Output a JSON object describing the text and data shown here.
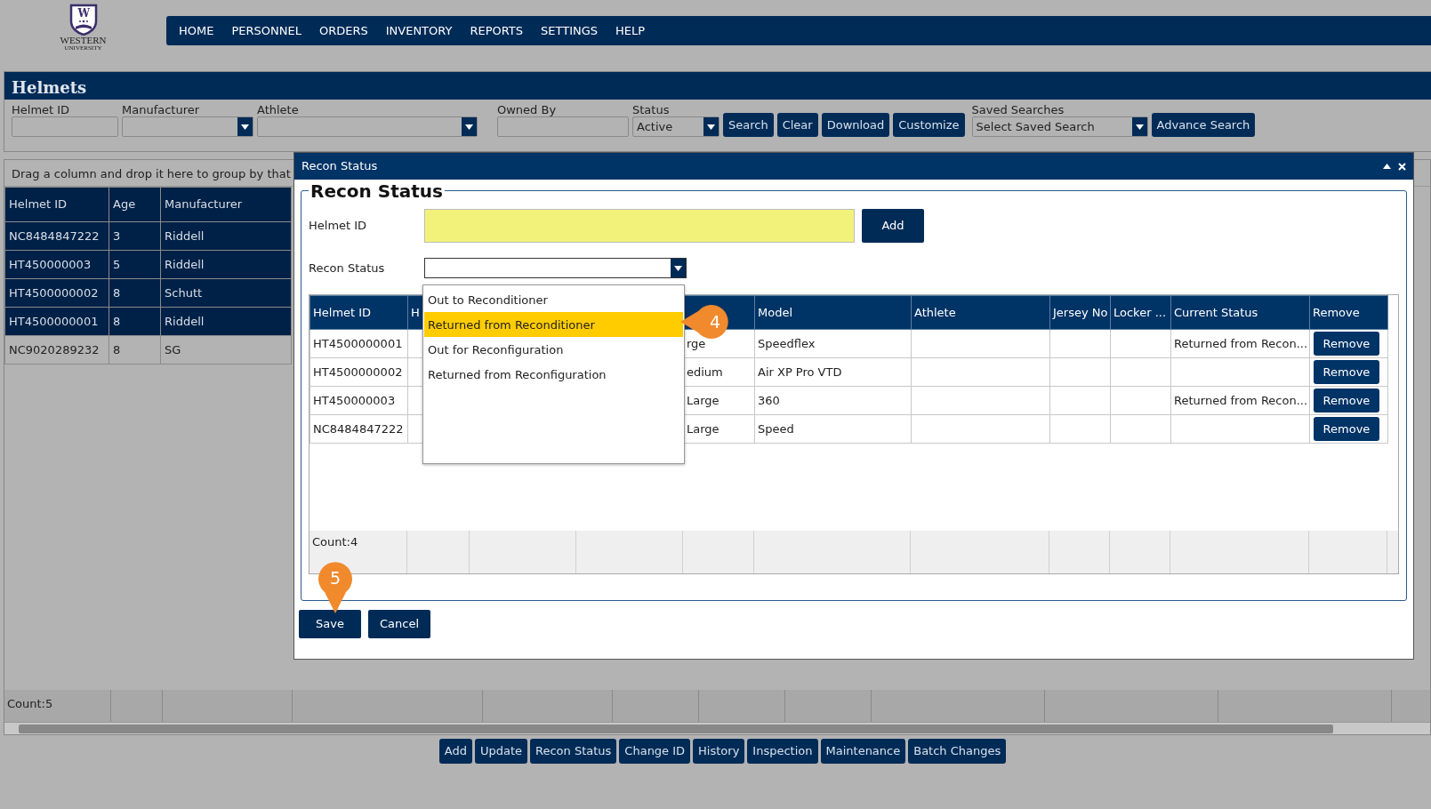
{
  "logo": {
    "letter": "W",
    "name": "WESTERN",
    "subtitle": "UNIVERSITY"
  },
  "nav": [
    "HOME",
    "PERSONNEL",
    "ORDERS",
    "INVENTORY",
    "REPORTS",
    "SETTINGS",
    "HELP"
  ],
  "panel": {
    "title": "Helmets",
    "filters": [
      {
        "kind": "text",
        "label": "Helmet ID"
      },
      {
        "kind": "select",
        "label": "Manufacturer"
      },
      {
        "kind": "select",
        "label": "Athlete"
      },
      {
        "kind": "text",
        "label": "Owned By"
      },
      {
        "kind": "select",
        "label": "Status",
        "value": "Active"
      }
    ],
    "buttons": [
      "Search",
      "Clear",
      "Download",
      "Customize"
    ],
    "saved_searches": {
      "label": "Saved Searches",
      "value": "Select Saved Search"
    },
    "advance_button": "Advance Search"
  },
  "grid": {
    "group_hint": "Drag a column and drop it here to group by that",
    "columns": [
      "Helmet ID",
      "Age",
      "Manufacturer"
    ],
    "rows": [
      {
        "cells": [
          "NC8484847222",
          "3",
          "Riddell"
        ],
        "selected": true
      },
      {
        "cells": [
          "HT450000003",
          "5",
          "Riddell"
        ],
        "selected": true
      },
      {
        "cells": [
          "HT4500000002",
          "8",
          "Schutt"
        ],
        "selected": true
      },
      {
        "cells": [
          "HT4500000001",
          "8",
          "Riddell"
        ],
        "selected": true
      },
      {
        "cells": [
          "NC9020289232",
          "8",
          "SG"
        ],
        "selected": false
      }
    ],
    "count": "Count:5"
  },
  "actions": [
    "Add",
    "Update",
    "Recon Status",
    "Change ID",
    "History",
    "Inspection",
    "Maintenance",
    "Batch Changes"
  ],
  "dialog": {
    "title": "Recon Status",
    "legend": "Recon Status",
    "helmet_id": {
      "label": "Helmet ID",
      "add_button": "Add"
    },
    "recon_status": {
      "label": "Recon Status",
      "expanded": true,
      "options": [
        {
          "label": "Out to Reconditioner",
          "selected": false
        },
        {
          "label": "Returned from Reconditioner",
          "selected": true
        },
        {
          "label": "Out for Reconfiguration",
          "selected": false
        },
        {
          "label": "Returned from Reconfiguration",
          "selected": false
        }
      ]
    },
    "table": {
      "columns": [
        "Helmet ID",
        "H",
        "Model",
        "Athlete",
        "Jersey No",
        "Locker ...",
        "Current Status",
        "Remove"
      ],
      "rows": [
        {
          "helmet_id": "HT4500000001",
          "column_5": "rge",
          "model": "Speedflex",
          "current_status": "Returned from Recon...",
          "remove": "Remove"
        },
        {
          "helmet_id": "HT4500000002",
          "column_5": "edium",
          "model": "Air XP Pro VTD",
          "remove": "Remove"
        },
        {
          "helmet_id": "HT450000003",
          "column_5": "Large",
          "model": "360",
          "current_status": "Returned from Recon...",
          "remove": "Remove"
        },
        {
          "helmet_id": "NC8484847222",
          "column_5": "Large",
          "model": "Speed",
          "remove": "Remove"
        }
      ],
      "count": "Count:4"
    },
    "buttons": [
      "Save",
      "Cancel"
    ]
  },
  "callouts": [
    "4",
    "5"
  ]
}
